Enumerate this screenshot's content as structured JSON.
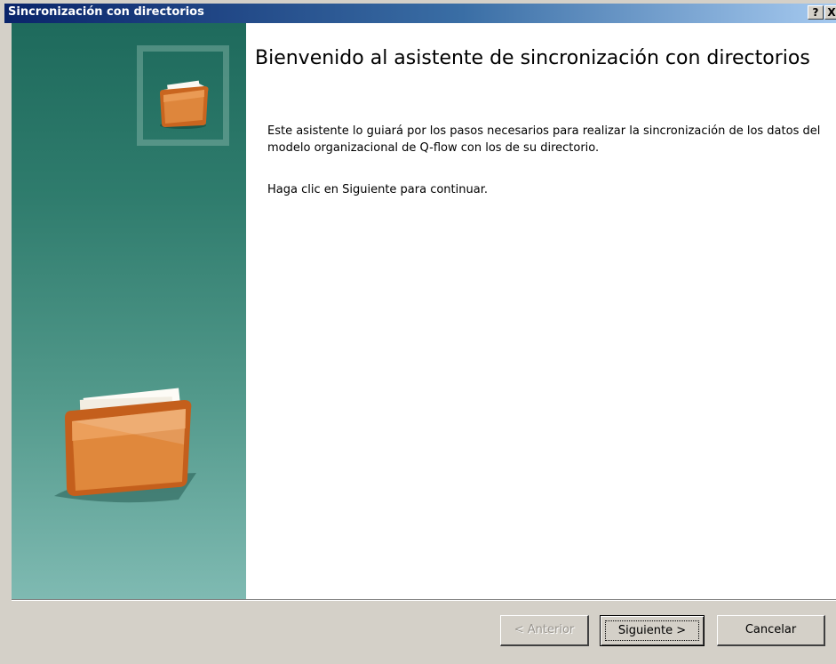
{
  "window": {
    "title": "Sincronización con directorios",
    "help_label": "?",
    "close_label": "X"
  },
  "wizard": {
    "heading": "Bienvenido al asistente de sincronización con directorios",
    "paragraph1": "Este asistente lo guiará por los pasos necesarios para realizar la sincronización de los datos del modelo organizacional de Q-flow con los de su directorio.",
    "paragraph2": "Haga clic en Siguiente para continuar."
  },
  "buttons": {
    "back_label": "< Anterior",
    "next_label": "Siguiente >",
    "cancel_label": "Cancelar"
  }
}
